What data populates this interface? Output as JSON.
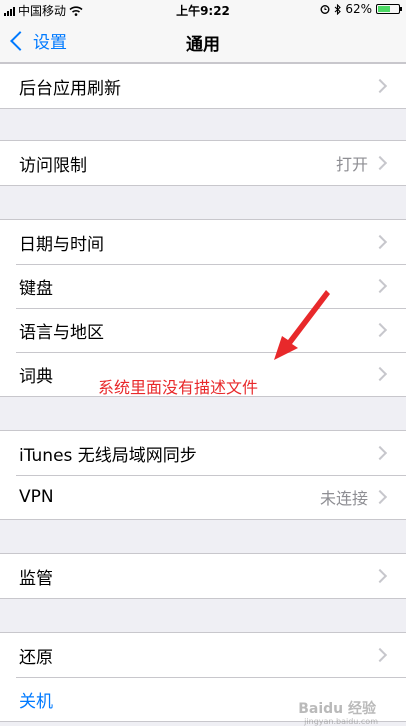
{
  "status": {
    "carrier": "中国移动",
    "time": "上午9:22",
    "battery_percent": "62%",
    "battery_level": 0.62
  },
  "nav": {
    "back_label": "设置",
    "title": "通用"
  },
  "groups": [
    {
      "rows": [
        {
          "label": "后台应用刷新",
          "value": ""
        }
      ]
    },
    {
      "rows": [
        {
          "label": "访问限制",
          "value": "打开"
        }
      ]
    },
    {
      "rows": [
        {
          "label": "日期与时间",
          "value": ""
        },
        {
          "label": "键盘",
          "value": ""
        },
        {
          "label": "语言与地区",
          "value": ""
        },
        {
          "label": "词典",
          "value": ""
        }
      ]
    },
    {
      "rows": [
        {
          "label": "iTunes 无线局域网同步",
          "value": ""
        },
        {
          "label": "VPN",
          "value": "未连接"
        }
      ]
    },
    {
      "rows": [
        {
          "label": "监管",
          "value": ""
        }
      ]
    },
    {
      "rows": [
        {
          "label": "还原",
          "value": ""
        },
        {
          "label": "关机",
          "value": ""
        }
      ]
    }
  ],
  "annotation": {
    "text": "系统里面没有描述文件",
    "color": "#e8292b"
  },
  "watermark": {
    "text": "Baidu 经验",
    "subtext": "jingyan.baidu.com"
  },
  "colors": {
    "accent": "#007aff",
    "background": "#efeff4",
    "battery": "#4cd964"
  }
}
